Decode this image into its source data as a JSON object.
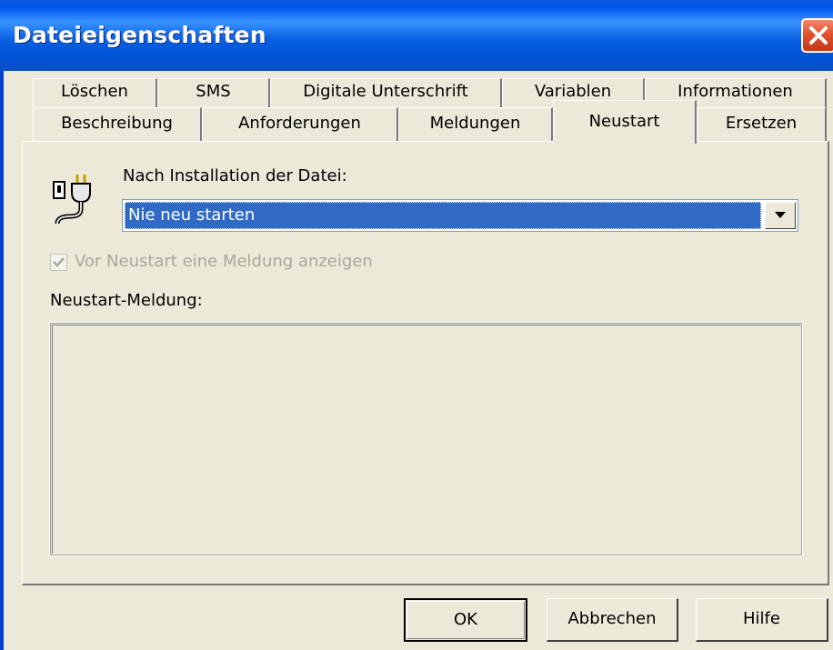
{
  "window": {
    "title": "Dateieigenschaften",
    "close_icon": "close-icon",
    "accent_color": "#0053d6",
    "close_color": "#e2532e"
  },
  "tabs": {
    "row1": [
      {
        "label": "Löschen"
      },
      {
        "label": "SMS"
      },
      {
        "label": "Digitale Unterschrift"
      },
      {
        "label": "Variablen"
      },
      {
        "label": "Informationen"
      }
    ],
    "row2": [
      {
        "label": "Beschreibung"
      },
      {
        "label": "Anforderungen"
      },
      {
        "label": "Meldungen"
      },
      {
        "label": "Neustart",
        "active": true
      },
      {
        "label": "Ersetzen"
      }
    ]
  },
  "neustart": {
    "icon": "plug-icon",
    "nach_label": "Nach Installation der Datei:",
    "select_value": "Nie neu starten",
    "checkbox_checked": true,
    "checkbox_enabled": false,
    "checkbox_label": "Vor Neustart eine Meldung anzeigen",
    "message_label": "Neustart-Meldung:",
    "message_value": ""
  },
  "buttons": {
    "ok": "OK",
    "cancel": "Abbrechen",
    "help": "Hilfe"
  }
}
